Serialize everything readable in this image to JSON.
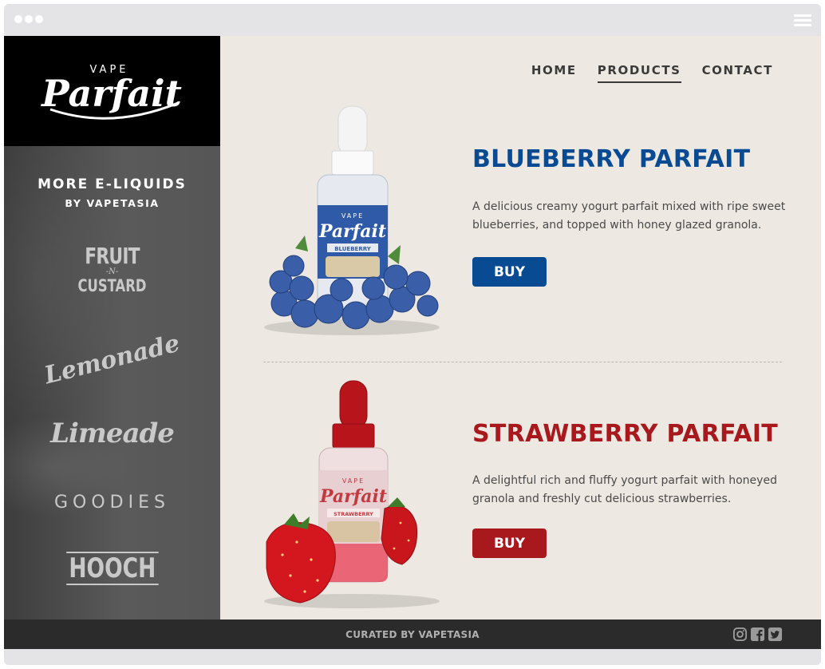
{
  "window": {
    "menu_icon": "hamburger-icon"
  },
  "logo": {
    "top": "VAPE",
    "main": "Parfait"
  },
  "sidebar": {
    "title": "MORE E-LIQUIDS",
    "subtitle": "BY VAPETASIA",
    "brands": {
      "fruit": {
        "line1": "FRUIT",
        "line2": "-N-",
        "line3": "CUSTARD"
      },
      "lemonade": "Lemonade",
      "limeade": "Limeade",
      "goodies": "GOODIES",
      "hooch": "HOOCH"
    }
  },
  "nav": {
    "home": "HOME",
    "products": "PRODUCTS",
    "contact": "CONTACT",
    "active": "PRODUCTS"
  },
  "products": [
    {
      "name": "BLUEBERRY PARFAIT",
      "description": "A delicious creamy yogurt parfait mixed with ripe sweet blueberries, and topped with honey glazed granola.",
      "buy_label": "BUY",
      "color": "#094b93",
      "label_logo": {
        "top": "VAPE",
        "main": "Parfait",
        "flavor": "BLUEBERRY"
      }
    },
    {
      "name": "STRAWBERRY PARFAIT",
      "description": "A delightful rich and fluffy yogurt parfait with honeyed granola and freshly cut delicious strawberries.",
      "buy_label": "BUY",
      "color": "#a8191d",
      "label_logo": {
        "top": "VAPE",
        "main": "Parfait",
        "flavor": "STRAWBERRY"
      }
    }
  ],
  "footer": {
    "text": "CURATED BY VAPETASIA",
    "social": [
      "instagram-icon",
      "facebook-icon",
      "twitter-icon"
    ]
  }
}
